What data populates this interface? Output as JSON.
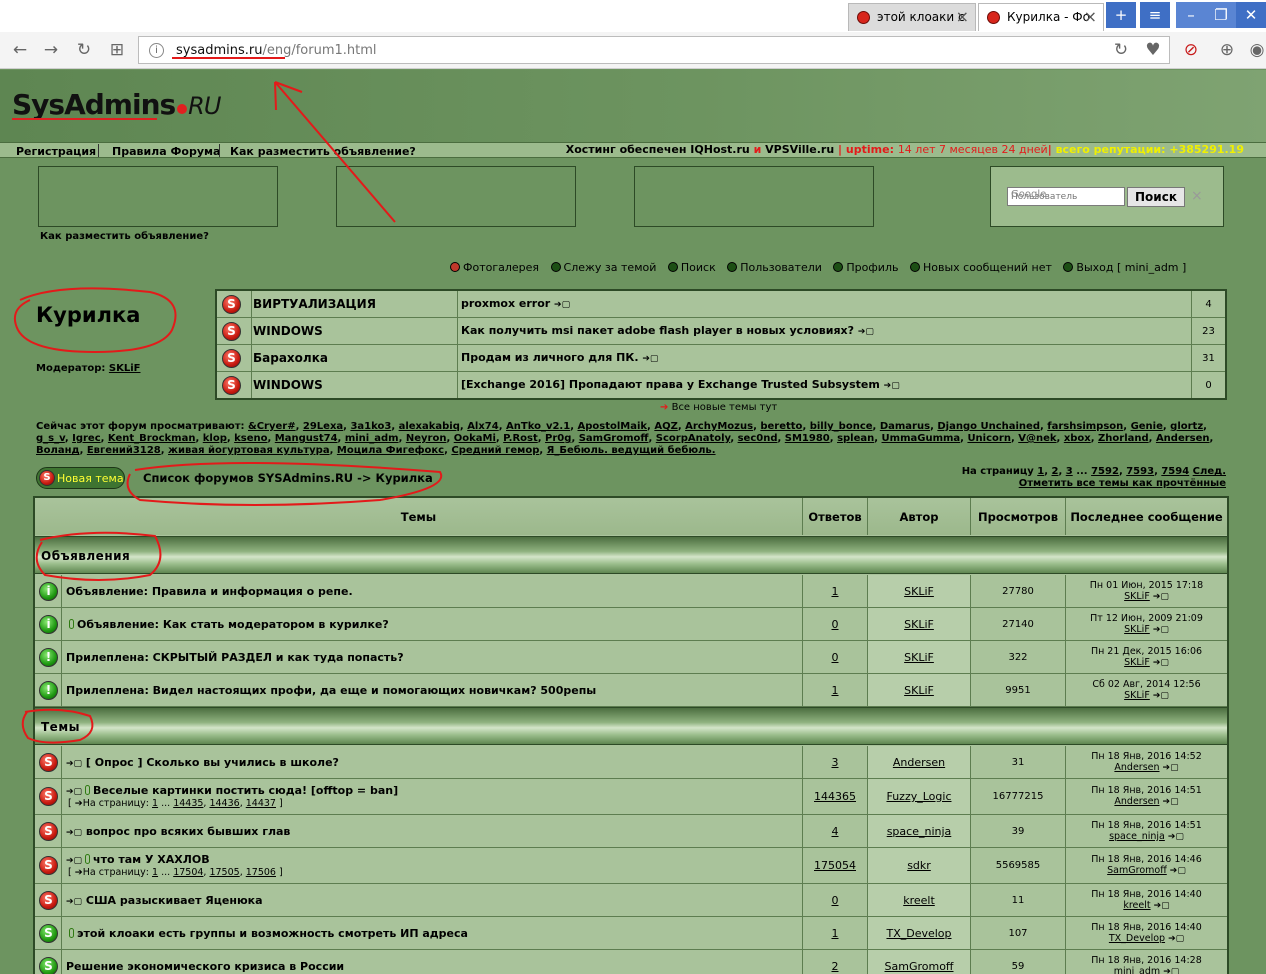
{
  "browser": {
    "tabs": [
      {
        "title": "этой клоаки с"
      },
      {
        "title": "Курилка - Фо"
      }
    ],
    "url_host": "sysadmins.ru",
    "url_path": "/eng/forum1.html"
  },
  "site": {
    "logo_main": "SysAdmins",
    "logo_ru": "RU",
    "menu": [
      "Регистрация",
      "Правила Форума",
      "Как разместить объявление?"
    ],
    "hosting_text": "Хостинг обеспечен IQHost.ru",
    "hosting_and": "и",
    "hosting_second": "VPSVille.ru",
    "uptime_label": "uptime:",
    "uptime_value": "14 лет 7 месяцев 24 дней",
    "reputation_label": "всего репутации:",
    "reputation_value": "+385291.19",
    "ad_link": "Как разместить объявление?",
    "search_placeholder": "Пользователь",
    "search_google": "Google",
    "search_button": "Поиск"
  },
  "usermenu": [
    "Фотогалерея",
    "Слежу за темой",
    "Поиск",
    "Пользователи",
    "Профиль",
    "Новых сообщений нет",
    "Выход [ mini_adm ]"
  ],
  "forum": {
    "title": "Курилка",
    "moderator_label": "Модератор:",
    "moderator": "SKLiF"
  },
  "recent": [
    {
      "category": "ВИРТУАЛИЗАЦИЯ",
      "topic": "proxmox error",
      "count": "4"
    },
    {
      "category": "WINDOWS",
      "topic": "Как получить msi пакет adobe flash player в новых условиях?",
      "count": "23"
    },
    {
      "category": "Барахолка",
      "topic": "Продам из личного для ПК.",
      "count": "31"
    },
    {
      "category": "WINDOWS",
      "topic": "[Exchange 2016] Пропадают права у Exchange Trusted Subsystem",
      "count": "0"
    }
  ],
  "all_new_topics": "Все новые темы тут",
  "viewers_label": "Сейчас этот форум просматривают:",
  "viewers": [
    "&Cryer#",
    "29Lexa",
    "3a1ko3",
    "alexakabiq",
    "Alx74",
    "AnTko_v2.1",
    "ApostolMaik",
    "AQZ",
    "ArchyMozus",
    "beretto",
    "billy_bonce",
    "Damarus",
    "Django Unchained",
    "farshsimpson",
    "Genie",
    "glortz",
    "g_s_v",
    "Igrec",
    "Kent_Brockman",
    "klop",
    "kseno",
    "Mangust74",
    "mini_adm",
    "Neyron",
    "OokaMi",
    "P.Rost",
    "Pr0g",
    "SamGromoff",
    "ScorpAnatoly",
    "sec0nd",
    "SM1980",
    "splean",
    "UmmaGumma",
    "Unicorn",
    "V@nek",
    "xbox",
    "Zhorland",
    "Andersen",
    "Воланд",
    "Евгений3128",
    "живая йогуртовая культура",
    "Моцила Фигефокс",
    "Средний гемор",
    "Я_Бебюль. ведущий бебюль."
  ],
  "toolbar": {
    "new_topic": "Новая тема",
    "breadcrumb": "Список форумов SYSAdmins.RU -> Курилка"
  },
  "pager": {
    "label": "На страницу",
    "pages": [
      "1",
      "2",
      "3",
      "...",
      "7592",
      "7593",
      "7594"
    ],
    "next": "След.",
    "mark_read": "Отметить все темы как прочтённые"
  },
  "table": {
    "headers": {
      "topics": "Темы",
      "replies": "Ответов",
      "author": "Автор",
      "views": "Просмотров",
      "last": "Последнее сообщение"
    },
    "section_announce": "Объявления",
    "section_topics": "Темы",
    "page_label": "На страницу:",
    "announcements": [
      {
        "title": "Объявление: Правила и информация о репе.",
        "replies": "1",
        "author": "SKLiF",
        "views": "27780",
        "last_date": "Пн 01 Июн, 2015 17:18",
        "last_user": "SKLiF"
      },
      {
        "title": "Объявление: Как стать модератором в курилке?",
        "replies": "0",
        "author": "SKLiF",
        "views": "27140",
        "last_date": "Пт 12 Июн, 2009 21:09",
        "last_user": "SKLiF"
      },
      {
        "title": "Прилеплена: СКРЫТЫЙ РАЗДЕЛ и как туда попасть?",
        "replies": "0",
        "author": "SKLiF",
        "views": "322",
        "last_date": "Пн 21 Дек, 2015 16:06",
        "last_user": "SKLiF"
      },
      {
        "title": "Прилеплена: Видел настоящих профи, да еще и помогающих новичкам? 500репы",
        "replies": "1",
        "author": "SKLiF",
        "views": "9951",
        "last_date": "Сб 02 Авг, 2014 12:56",
        "last_user": "SKLiF"
      }
    ],
    "topics": [
      {
        "title": "[ Опрос ] Сколько вы учились в школе?",
        "replies": "3",
        "author": "Andersen",
        "views": "31",
        "last_date": "Пн 18 Янв, 2016 14:52",
        "last_user": "Andersen"
      },
      {
        "title": "Веселые картинки постить сюда! [offtop = ban]",
        "pages": [
          "1",
          "...",
          "14435",
          "14436",
          "14437"
        ],
        "replies": "144365",
        "author": "Fuzzy_Logic",
        "views": "16777215",
        "last_date": "Пн 18 Янв, 2016 14:51",
        "last_user": "Andersen"
      },
      {
        "title": "вопрос про всяких бывших глав",
        "replies": "4",
        "author": "space_ninja",
        "views": "39",
        "last_date": "Пн 18 Янв, 2016 14:51",
        "last_user": "space_ninja"
      },
      {
        "title": "что там У ХАХЛОВ",
        "pages": [
          "1",
          "...",
          "17504",
          "17505",
          "17506"
        ],
        "replies": "175054",
        "author": "sdkr",
        "views": "5569585",
        "last_date": "Пн 18 Янв, 2016 14:46",
        "last_user": "SamGromoff"
      },
      {
        "title": "США разыскивает Яценюка",
        "replies": "0",
        "author": "kreelt",
        "views": "11",
        "last_date": "Пн 18 Янв, 2016 14:40",
        "last_user": "kreelt"
      },
      {
        "title": "этой клоаки есть группы и возможность смотреть ИП адреса",
        "replies": "1",
        "author": "TX_Develop",
        "views": "107",
        "last_date": "Пн 18 Янв, 2016 14:40",
        "last_user": "TX_Develop"
      },
      {
        "title": "Решение экономического кризиса в России",
        "replies": "2",
        "author": "SamGromoff",
        "views": "59",
        "last_date": "Пн 18 Янв, 2016 14:28",
        "last_user": "mini_adm"
      }
    ]
  }
}
